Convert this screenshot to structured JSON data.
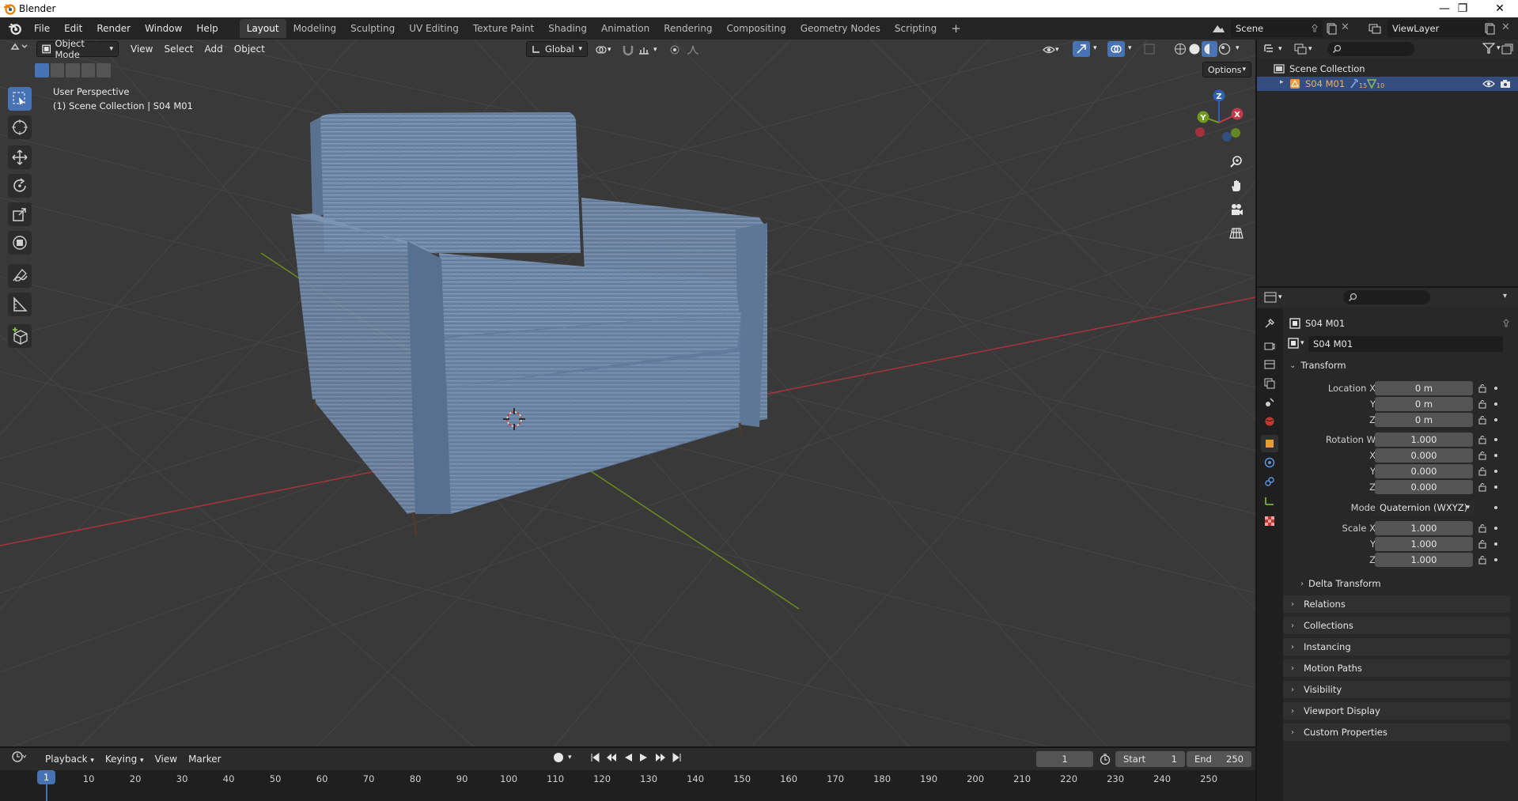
{
  "window": {
    "title": "Blender",
    "minimize": "—",
    "maximize": "❐",
    "close": "✕"
  },
  "menu": {
    "items": [
      "File",
      "Edit",
      "Render",
      "Window",
      "Help"
    ]
  },
  "workspaces": {
    "tabs": [
      "Layout",
      "Modeling",
      "Sculpting",
      "UV Editing",
      "Texture Paint",
      "Shading",
      "Animation",
      "Rendering",
      "Compositing",
      "Geometry Nodes",
      "Scripting"
    ],
    "active": "Layout",
    "add": "+"
  },
  "scene": {
    "name": "Scene",
    "view_layer": "ViewLayer"
  },
  "viewport": {
    "mode": "Object Mode",
    "menus": [
      "View",
      "Select",
      "Add",
      "Object"
    ],
    "transform_orientation": "Global",
    "options_label": "Options",
    "overlay_title": "User Perspective",
    "overlay_subtitle": "(1) Scene Collection | S04 M01",
    "gizmo": {
      "z": "Z",
      "y": "Y",
      "x": "X"
    },
    "colors": {
      "bg": "#393939",
      "grid": "#464646",
      "x_axis": "#a8343f",
      "y_axis": "#6d8a1e",
      "fabric": "#6f88a8",
      "active": "#4772b3"
    }
  },
  "outliner": {
    "root": "Scene Collection",
    "items": [
      {
        "name": "S04 M01",
        "modifier_count": "15",
        "constraint_count": "10",
        "selected": true
      }
    ]
  },
  "properties": {
    "object_name": "S04 M01",
    "datablock_name": "S04 M01",
    "transform": {
      "header": "Transform",
      "location": {
        "label": "Location X",
        "x": "0 m",
        "y": "0 m",
        "z": "0 m"
      },
      "rotation": {
        "label": "Rotation W",
        "w": "1.000",
        "x": "0.000",
        "y": "0.000",
        "z": "0.000"
      },
      "mode": {
        "label": "Mode",
        "value": "Quaternion (WXYZ)"
      },
      "scale": {
        "label": "Scale X",
        "x": "1.000",
        "y": "1.000",
        "z": "1.000"
      },
      "axis_y": "Y",
      "axis_z": "Z",
      "axis_x": "X"
    },
    "delta_transform": "Delta Transform",
    "panels": [
      "Relations",
      "Collections",
      "Instancing",
      "Motion Paths",
      "Visibility",
      "Viewport Display",
      "Custom Properties"
    ]
  },
  "timeline": {
    "menus": [
      "Playback",
      "Keying",
      "View",
      "Marker"
    ],
    "current_frame": "1",
    "start_label": "Start",
    "start": "1",
    "end_label": "End",
    "end": "250",
    "ticks": [
      "10",
      "20",
      "30",
      "40",
      "50",
      "60",
      "70",
      "80",
      "90",
      "100",
      "110",
      "120",
      "130",
      "140",
      "150",
      "160",
      "170",
      "180",
      "190",
      "200",
      "210",
      "220",
      "230",
      "240",
      "250"
    ],
    "playhead": "1"
  }
}
